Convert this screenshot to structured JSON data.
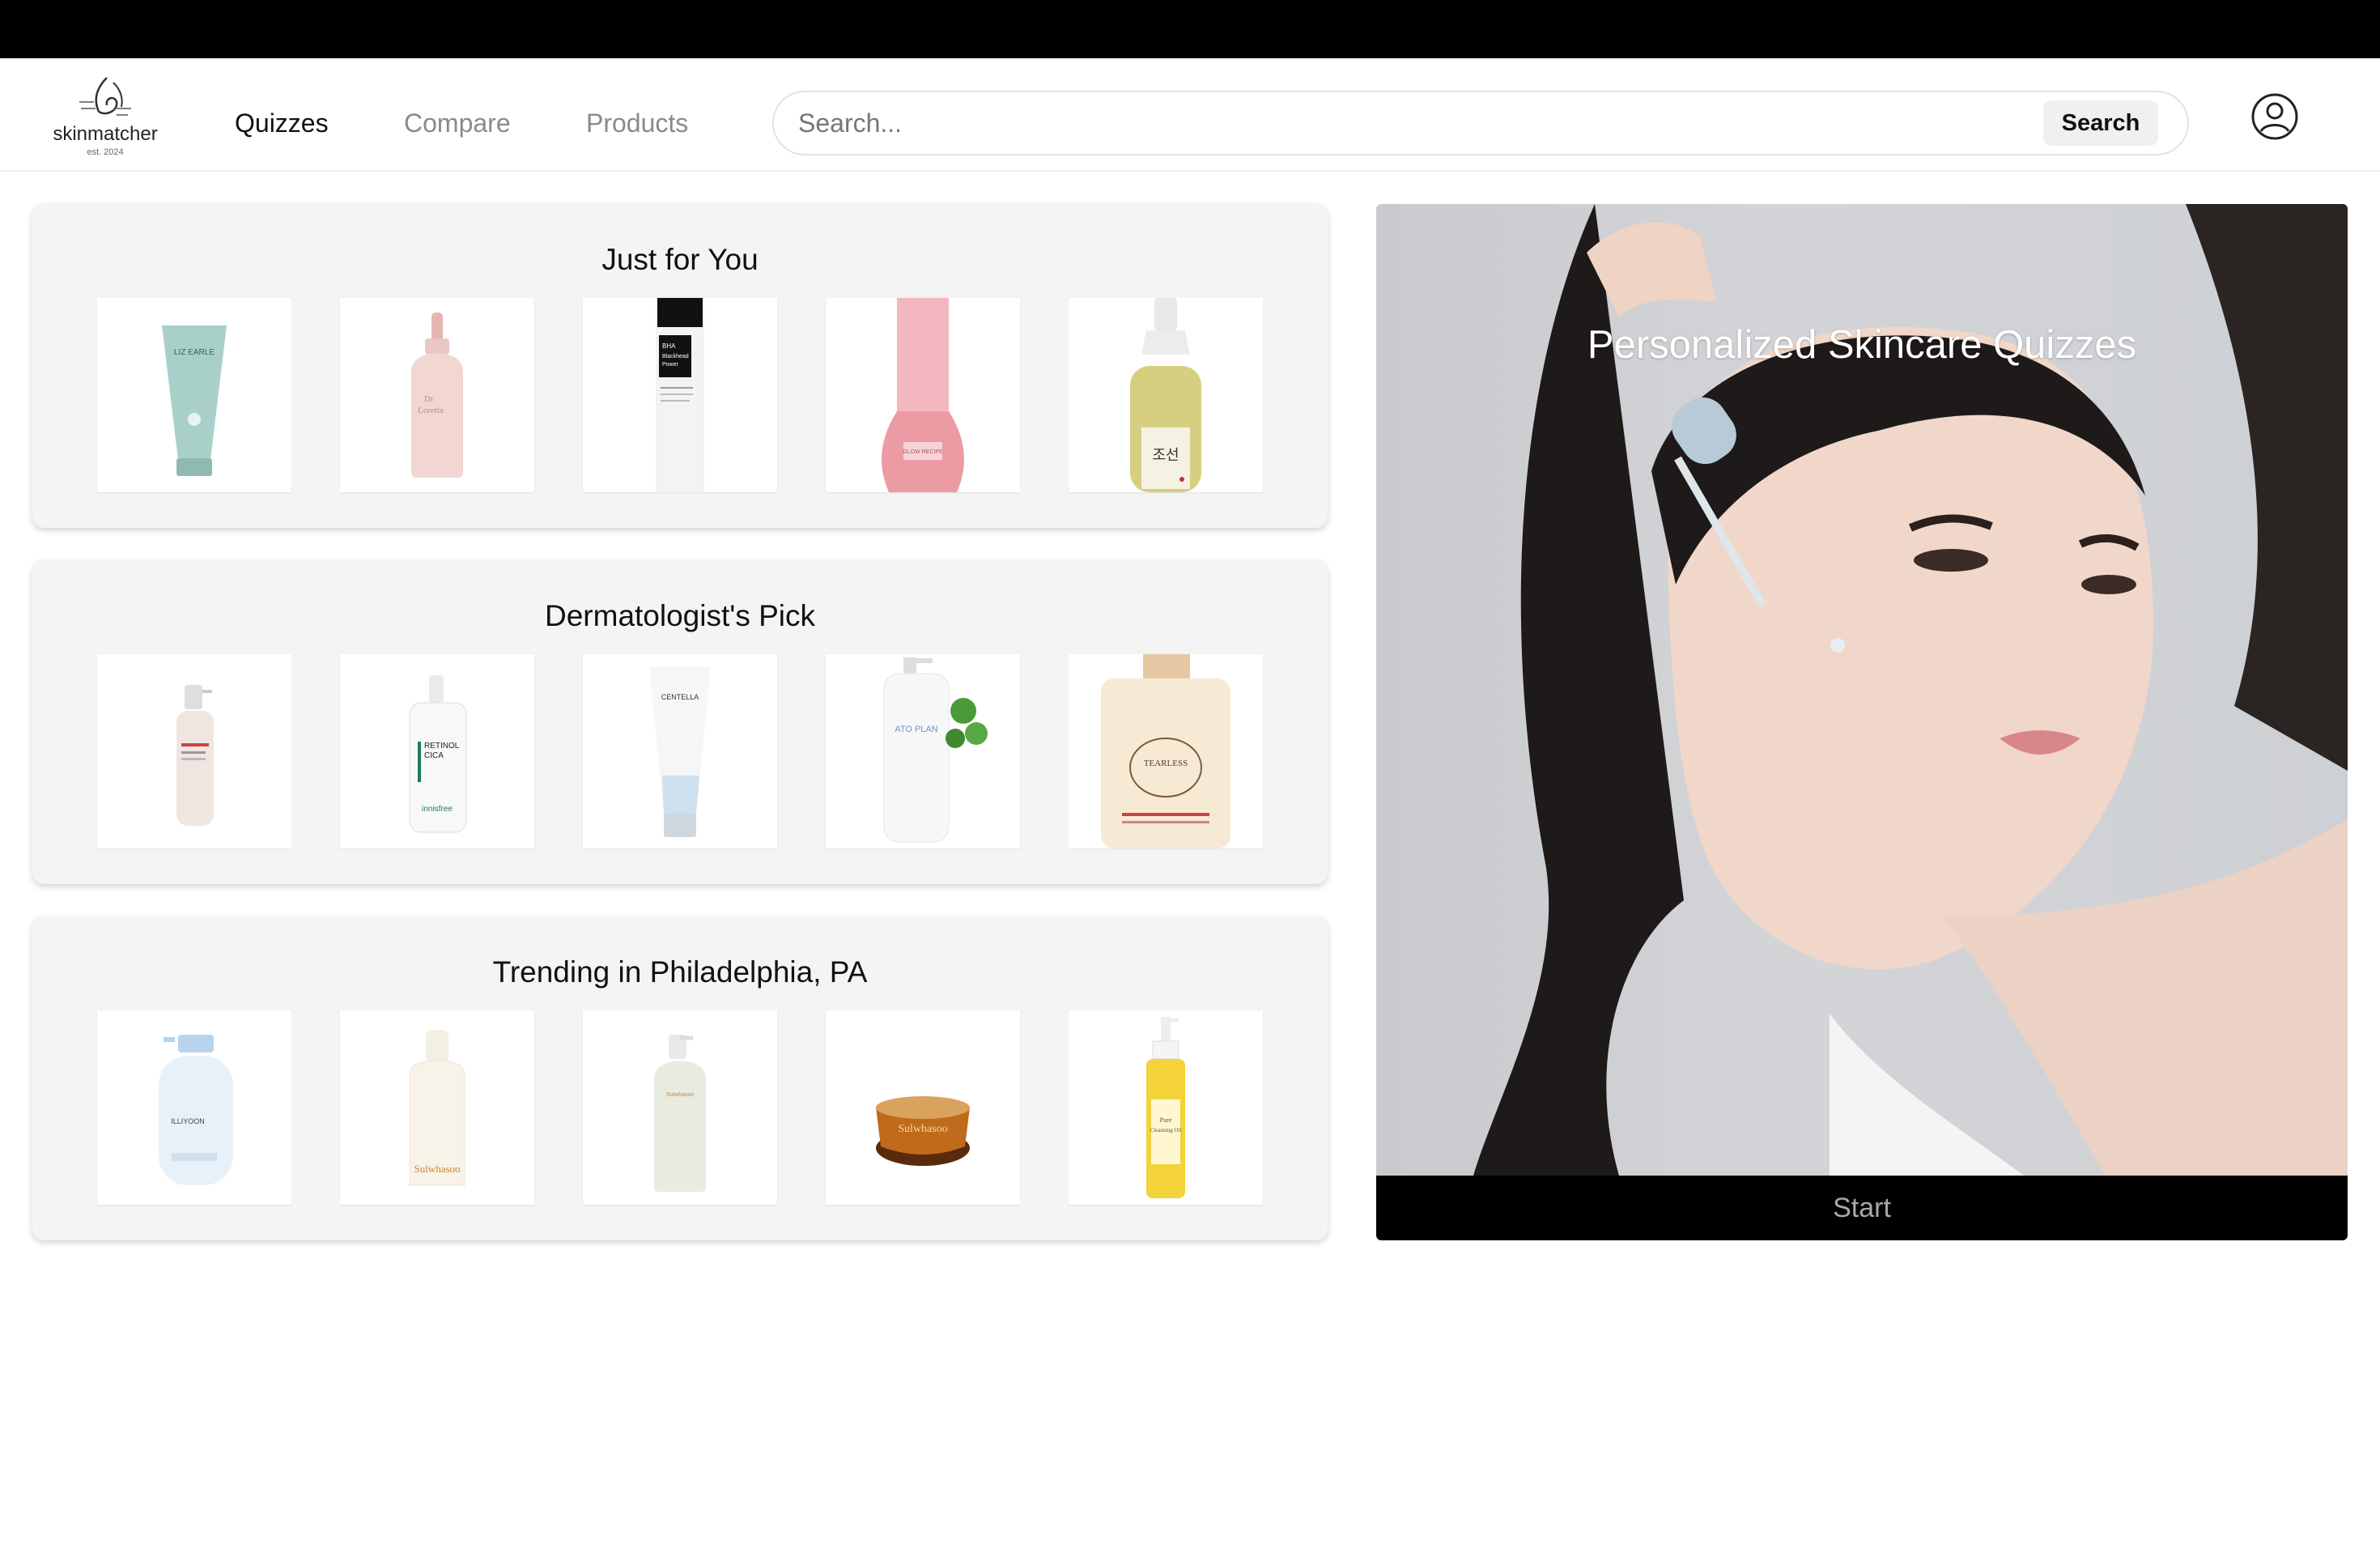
{
  "brand": {
    "name": "skinmatcher",
    "est": "est. 2024"
  },
  "nav": {
    "links": [
      {
        "label": "Quizzes",
        "active": true
      },
      {
        "label": "Compare",
        "active": false
      },
      {
        "label": "Products",
        "active": false
      }
    ]
  },
  "search": {
    "placeholder": "Search...",
    "button_label": "Search"
  },
  "account": {
    "icon": "user-circle-icon"
  },
  "sections": [
    {
      "title": "Just for You",
      "products": [
        {
          "image": "liz-earle-tube"
        },
        {
          "image": "dr-loretta-dropper-bottle"
        },
        {
          "image": "cosrx-bha-liquid"
        },
        {
          "image": "pink-dewy-serum-bottle"
        },
        {
          "image": "beauty-of-joseon-glow-serum"
        }
      ]
    },
    {
      "title": "Dermatologist's Pick",
      "products": [
        {
          "image": "pump-serum-bottle"
        },
        {
          "image": "innisfree-retinol-cica"
        },
        {
          "image": "centella-cream-tube"
        },
        {
          "image": "ato-plan-lotion"
        },
        {
          "image": "tearless-shampoo"
        }
      ]
    },
    {
      "title": "Trending in Philadelphia, PA",
      "products": [
        {
          "image": "illiyoon-ceramide-lotion"
        },
        {
          "image": "sulwhasoo-first-care-serum"
        },
        {
          "image": "cream-pump-bottle"
        },
        {
          "image": "sulwhasoo-ginseng-cream-jar"
        },
        {
          "image": "ma-nyo-pure-cleansing-oil"
        }
      ]
    }
  ],
  "hero": {
    "title": "Personalized Skincare Quizzes",
    "image": "woman-applying-serum-dropper",
    "button_label": "Start"
  }
}
